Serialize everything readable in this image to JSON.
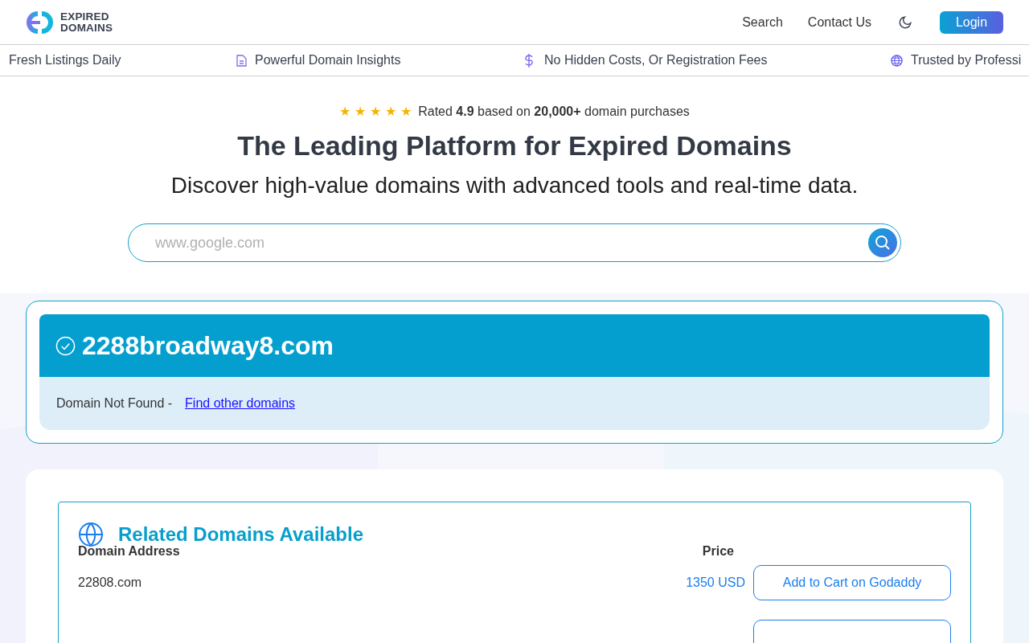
{
  "header": {
    "logo": [
      "EXPIRED",
      "DOMAINS"
    ],
    "nav": [
      "Search",
      "Contact Us"
    ],
    "login": "Login"
  },
  "ticker": [
    {
      "kind": "none",
      "text": "Fresh Listings Daily"
    },
    {
      "kind": "document",
      "text": "Powerful Domain Insights"
    },
    {
      "kind": "dollar",
      "text": "No Hidden Costs, Or Registration Fees"
    },
    {
      "kind": "globe",
      "text": "Trusted by Professi"
    }
  ],
  "hero": {
    "stars": 5,
    "rating": "Rated **4.9** based on **20,000+** domain purchases",
    "title": "The Leading Platform for Expired Domains",
    "subtitle": "Discover high-value domains with advanced tools and real-time data.",
    "search": {
      "placeholder": "www.google.com"
    }
  },
  "result": {
    "domain": "2288broadway8.com",
    "status": "Domain Not Found -",
    "link": "Find other domains"
  },
  "related": {
    "title": "Related Domains Available",
    "columns": [
      "Domain Address",
      "Price"
    ],
    "rows": [
      {
        "domain": "22808.com",
        "price": "1350 USD",
        "action": "Add to Cart on Godaddy"
      }
    ]
  }
}
